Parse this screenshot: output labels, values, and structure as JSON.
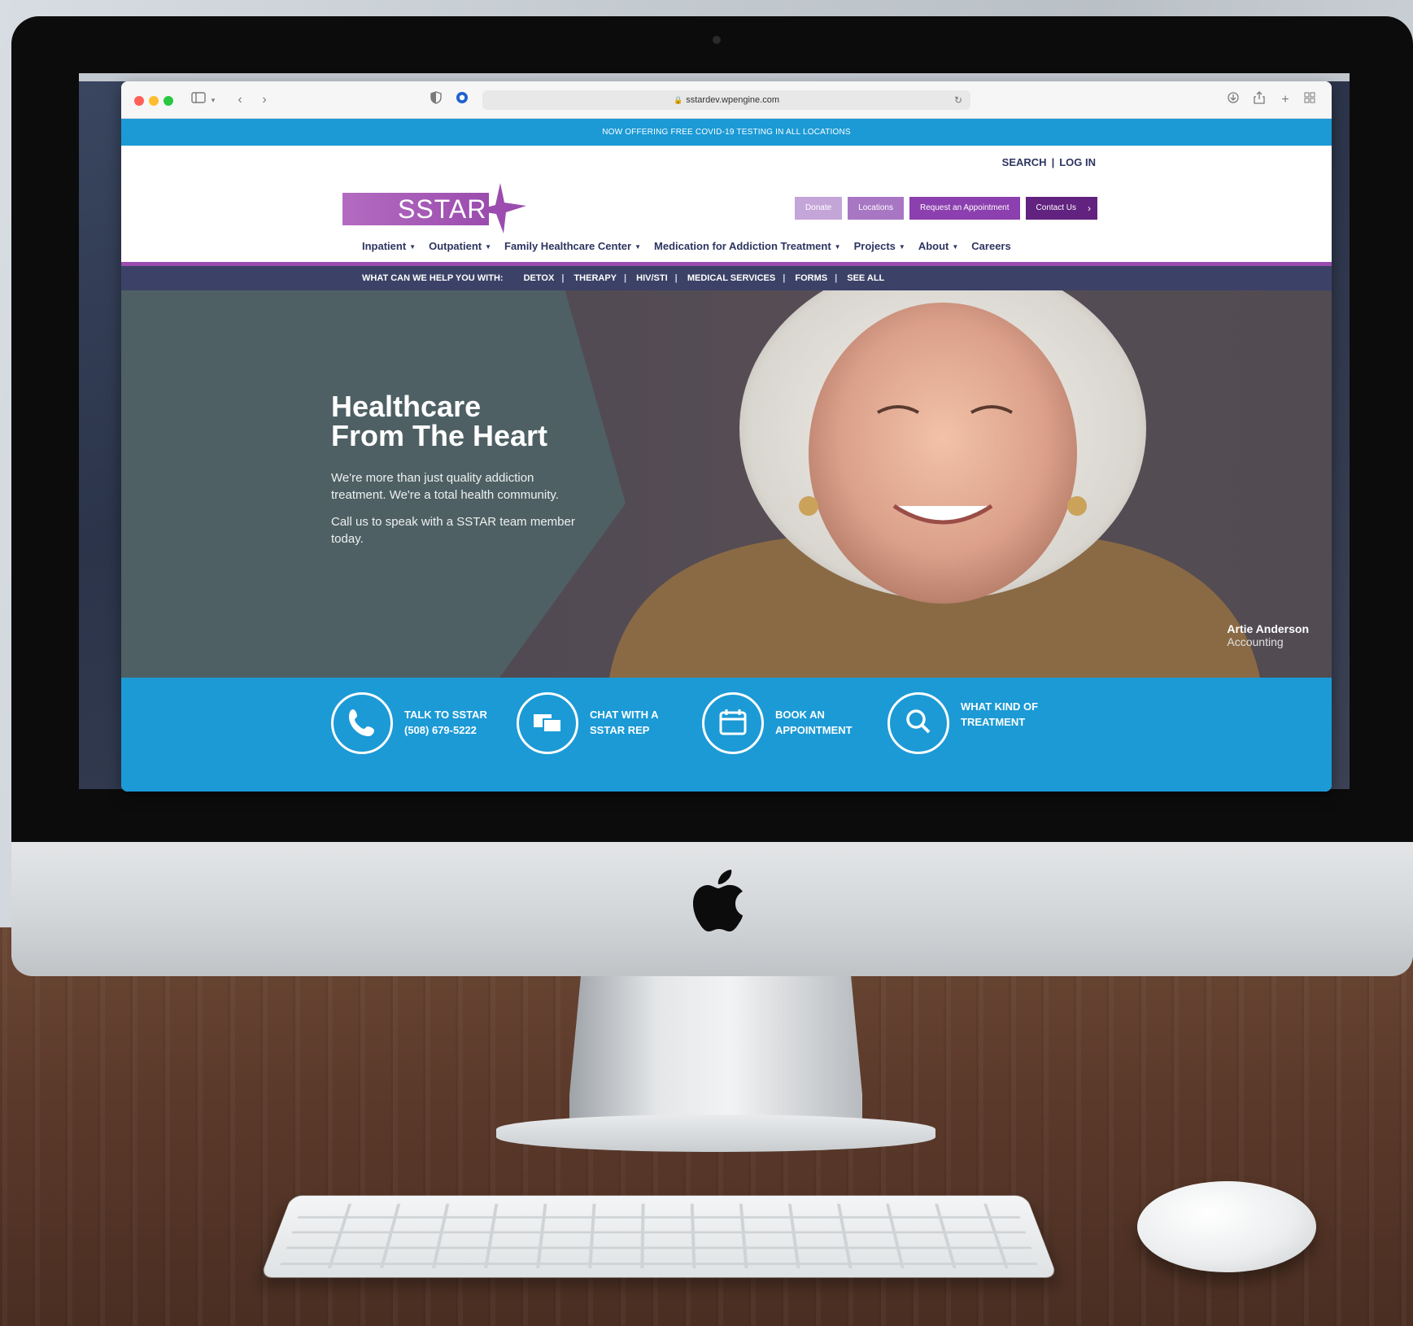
{
  "browser": {
    "url": "sstardev.wpengine.com"
  },
  "site": {
    "announcement": "NOW OFFERING FREE COVID-19 TESTING IN ALL LOCATIONS",
    "util_links": {
      "search": "SEARCH",
      "login": "LOG IN"
    },
    "logo_text": "SSTAR",
    "cta": {
      "donate": "Donate",
      "locations": "Locations",
      "request": "Request an Appointment",
      "contact": "Contact Us"
    },
    "nav": [
      {
        "label": "Inpatient"
      },
      {
        "label": "Outpatient"
      },
      {
        "label": "Family Healthcare Center"
      },
      {
        "label": "Medication for Addiction Treatment"
      },
      {
        "label": "Projects"
      },
      {
        "label": "About"
      },
      {
        "label": "Careers"
      }
    ],
    "helpbar": {
      "lead": "WHAT CAN WE HELP YOU WITH:",
      "links": [
        "DETOX",
        "THERAPY",
        "HIV/STI",
        "MEDICAL SERVICES",
        "FORMS",
        "SEE ALL"
      ]
    },
    "hero": {
      "title_line1": "Healthcare",
      "title_line2": "From The Heart",
      "body1": "We're more than just quality addiction treatment. We're a total health community.",
      "body2": "Call us to speak with a SSTAR team member today.",
      "caption_name": "Artie Anderson",
      "caption_role": "Accounting"
    },
    "actions": [
      {
        "icon": "phone-icon",
        "line1": "TALK TO SSTAR",
        "line2": "(508) 679-5222"
      },
      {
        "icon": "chat-icon",
        "line1": "CHAT WITH A",
        "line2": "SSTAR REP"
      },
      {
        "icon": "calendar-icon",
        "line1": "BOOK AN",
        "line2": "APPOINTMENT"
      },
      {
        "icon": "search-icon",
        "line1": "WHAT KIND OF",
        "line2": "TREATMENT"
      }
    ]
  }
}
